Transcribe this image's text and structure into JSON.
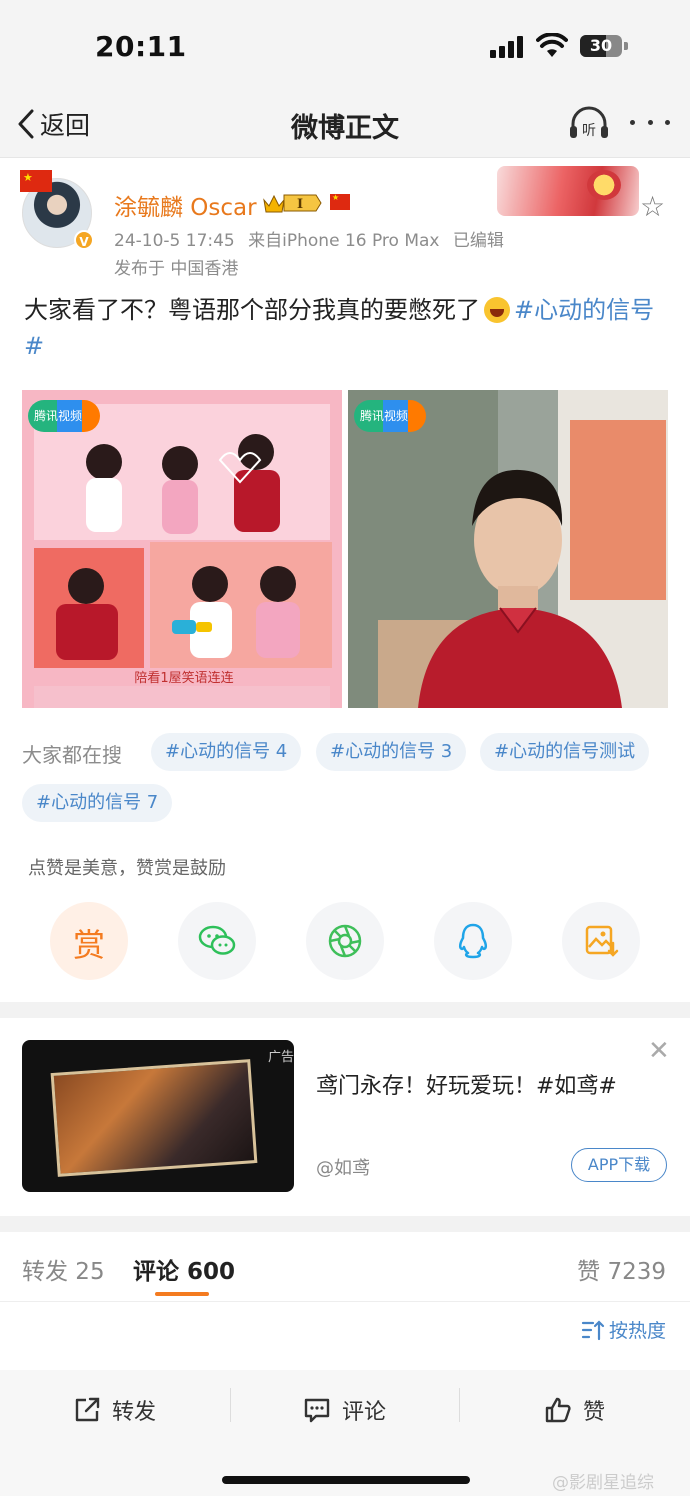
{
  "status_bar": {
    "time": "20:11",
    "battery": "30"
  },
  "nav": {
    "back_label": "返回",
    "title": "微博正文",
    "listen_label": "听"
  },
  "post": {
    "user_name": "涂毓麟 Oscar",
    "rank_badge": "I",
    "timestamp": "24-10-5 17:45",
    "source": "来自iPhone 16 Pro Max",
    "edited": "已编辑",
    "location": "发布于 中国香港",
    "text": "大家看了不？粤语那个部分我真的要憋死了",
    "hashtag": "#心动的信号#",
    "image1": {
      "logo": "腾讯视频",
      "caption": "陪看1屋笑语连连"
    },
    "image2": {
      "logo": "腾讯视频"
    }
  },
  "search": {
    "label": "大家都在搜",
    "chips": [
      "#心动的信号 4",
      "#心动的信号 3",
      "#心动的信号测试",
      "#心动的信号 7"
    ]
  },
  "actions": {
    "reward_hint": "点赞是美意，赞赏是鼓励",
    "reward_label": "赏",
    "icons": [
      "reward-icon",
      "wechat-icon",
      "moments-icon",
      "qq-icon",
      "save-image-icon"
    ]
  },
  "ad": {
    "tag": "广告",
    "text": "鸢门永存！好玩爱玩！#如鸢#",
    "author": "@如鸢",
    "button": "APP下载"
  },
  "stats": {
    "repost": "转发 25",
    "comment": "评论 600",
    "like": "赞 7239",
    "sort": "按热度"
  },
  "bottom_bar": {
    "repost": "转发",
    "comment": "评论",
    "like": "赞"
  },
  "watermark": "@影剧星追综",
  "colors": {
    "accent_orange": "#f47b20",
    "link_blue": "#4a87c9",
    "name_orange": "#e8791d"
  }
}
